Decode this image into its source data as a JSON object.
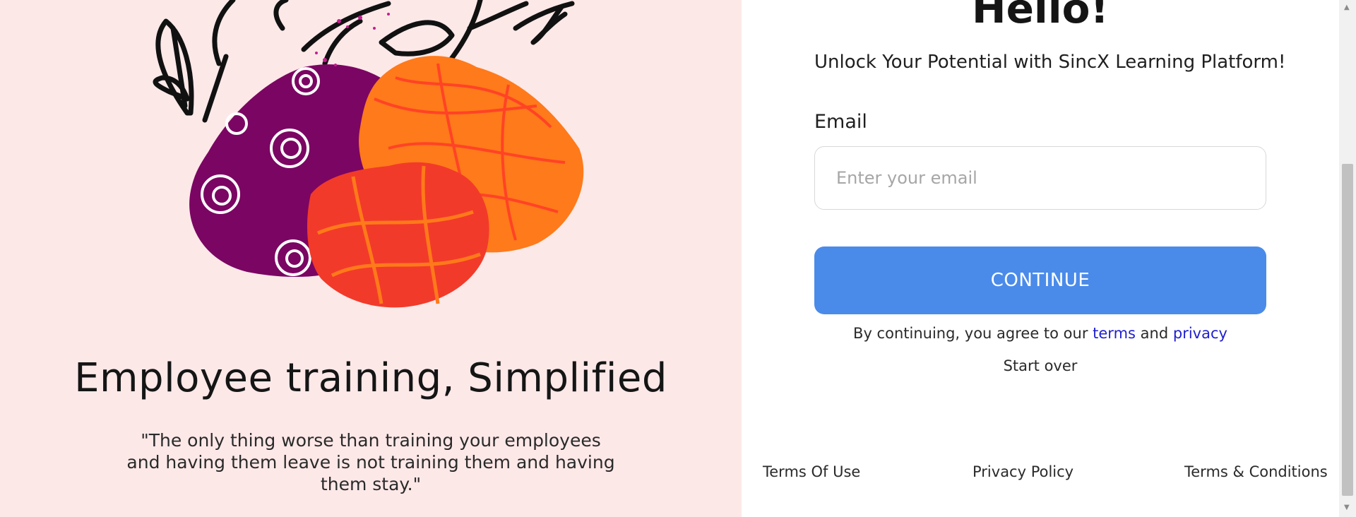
{
  "illustration": {
    "icon": "abstract-plant-illustration",
    "colors": {
      "purple": "#7b0563",
      "orange": "#ff7a1a",
      "red": "#f23a2a",
      "ink": "#111111",
      "stripe": "#ff5a2a"
    }
  },
  "left_panel": {
    "heading": "Employee training, Simplified",
    "quote": "\"The only thing worse than training your employees and having them leave is not training them and having them stay.\"",
    "background": "#fde8e8"
  },
  "login": {
    "greeting": "Hello!",
    "subtitle": "Unlock Your Potential with SincX Learning Platform!",
    "email_label": "Email",
    "email_value": "",
    "email_placeholder": "Enter your email",
    "continue_label": "CONTINUE",
    "continue_color": "#4a8bea",
    "consent_prefix": "By continuing, you agree to our",
    "terms_label": "terms",
    "consent_and": "and",
    "privacy_label": "privacy",
    "link_color": "#1f1fcf",
    "start_over_label": "Start over"
  },
  "footer": {
    "terms_of_use": "Terms Of Use",
    "privacy_policy": "Privacy Policy",
    "terms_conditions": "Terms & Conditions"
  },
  "scrollbar": {
    "up_icon": "scroll-up-arrow",
    "down_icon": "scroll-down-arrow"
  }
}
